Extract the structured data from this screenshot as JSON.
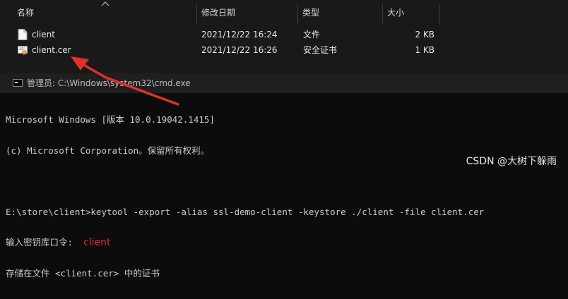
{
  "explorer": {
    "columns": {
      "name": "名称",
      "modified": "修改日期",
      "type": "类型",
      "size": "大小"
    },
    "files": [
      {
        "name": "client",
        "modified": "2021/12/22 16:24",
        "type": "文件",
        "size": "2 KB",
        "icon": "file-icon"
      },
      {
        "name": "client.cer",
        "modified": "2021/12/22 16:26",
        "type": "安全证书",
        "size": "1 KB",
        "icon": "certificate-icon"
      }
    ]
  },
  "annotation": {
    "color": "#e0302a"
  },
  "cmd": {
    "title": "管理员: C:\\Windows\\system32\\cmd.exe",
    "lines": [
      "Microsoft Windows [版本 10.0.19042.1415]",
      "(c) Microsoft Corporation。保留所有权利。",
      "",
      "E:\\store\\client>keytool -export -alias ssl-demo-client -keystore ./client -file client.cer",
      "输入密钥库口令:",
      "存储在文件 <client.cer> 中的证书"
    ],
    "typed_password": "client"
  },
  "watermark": "CSDN @大树下躲雨"
}
